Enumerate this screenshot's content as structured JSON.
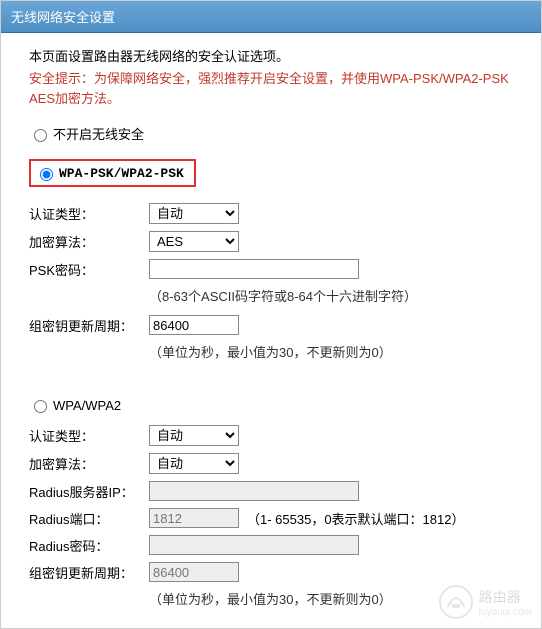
{
  "title": "无线网络安全设置",
  "intro": "本页面设置路由器无线网络的安全认证选项。",
  "warning": "安全提示：为保障网络安全，强烈推荐开启安全设置，并使用WPA-PSK/WPA2-PSK AES加密方法。",
  "security_mode": "wpa_psk",
  "modes": {
    "disable": {
      "label": "不开启无线安全"
    },
    "wpa_psk": {
      "label": "WPA-PSK/WPA2-PSK",
      "fields": {
        "auth_label": "认证类型：",
        "auth_value": "自动",
        "cipher_label": "加密算法：",
        "cipher_value": "AES",
        "psk_label": "PSK密码：",
        "psk_value": "",
        "psk_hint": "（8-63个ASCII码字符或8-64个十六进制字符）",
        "rekey_label": "组密钥更新周期：",
        "rekey_value": "86400",
        "rekey_hint": "（单位为秒，最小值为30，不更新则为0）"
      }
    },
    "wpa": {
      "label": "WPA/WPA2",
      "fields": {
        "auth_label": "认证类型：",
        "auth_value": "自动",
        "cipher_label": "加密算法：",
        "cipher_value": "自动",
        "radius_ip_label": "Radius服务器IP：",
        "radius_ip_value": "",
        "radius_port_label": "Radius端口：",
        "radius_port_value": "1812",
        "radius_port_hint": "（1- 65535，0表示默认端口：1812）",
        "radius_pwd_label": "Radius密码：",
        "radius_pwd_value": "",
        "rekey_label": "组密钥更新周期：",
        "rekey_value": "86400",
        "rekey_hint": "（单位为秒，最小值为30，不更新则为0）"
      }
    }
  },
  "watermark": {
    "text": "路由器",
    "sub": "luyouqi.com"
  }
}
